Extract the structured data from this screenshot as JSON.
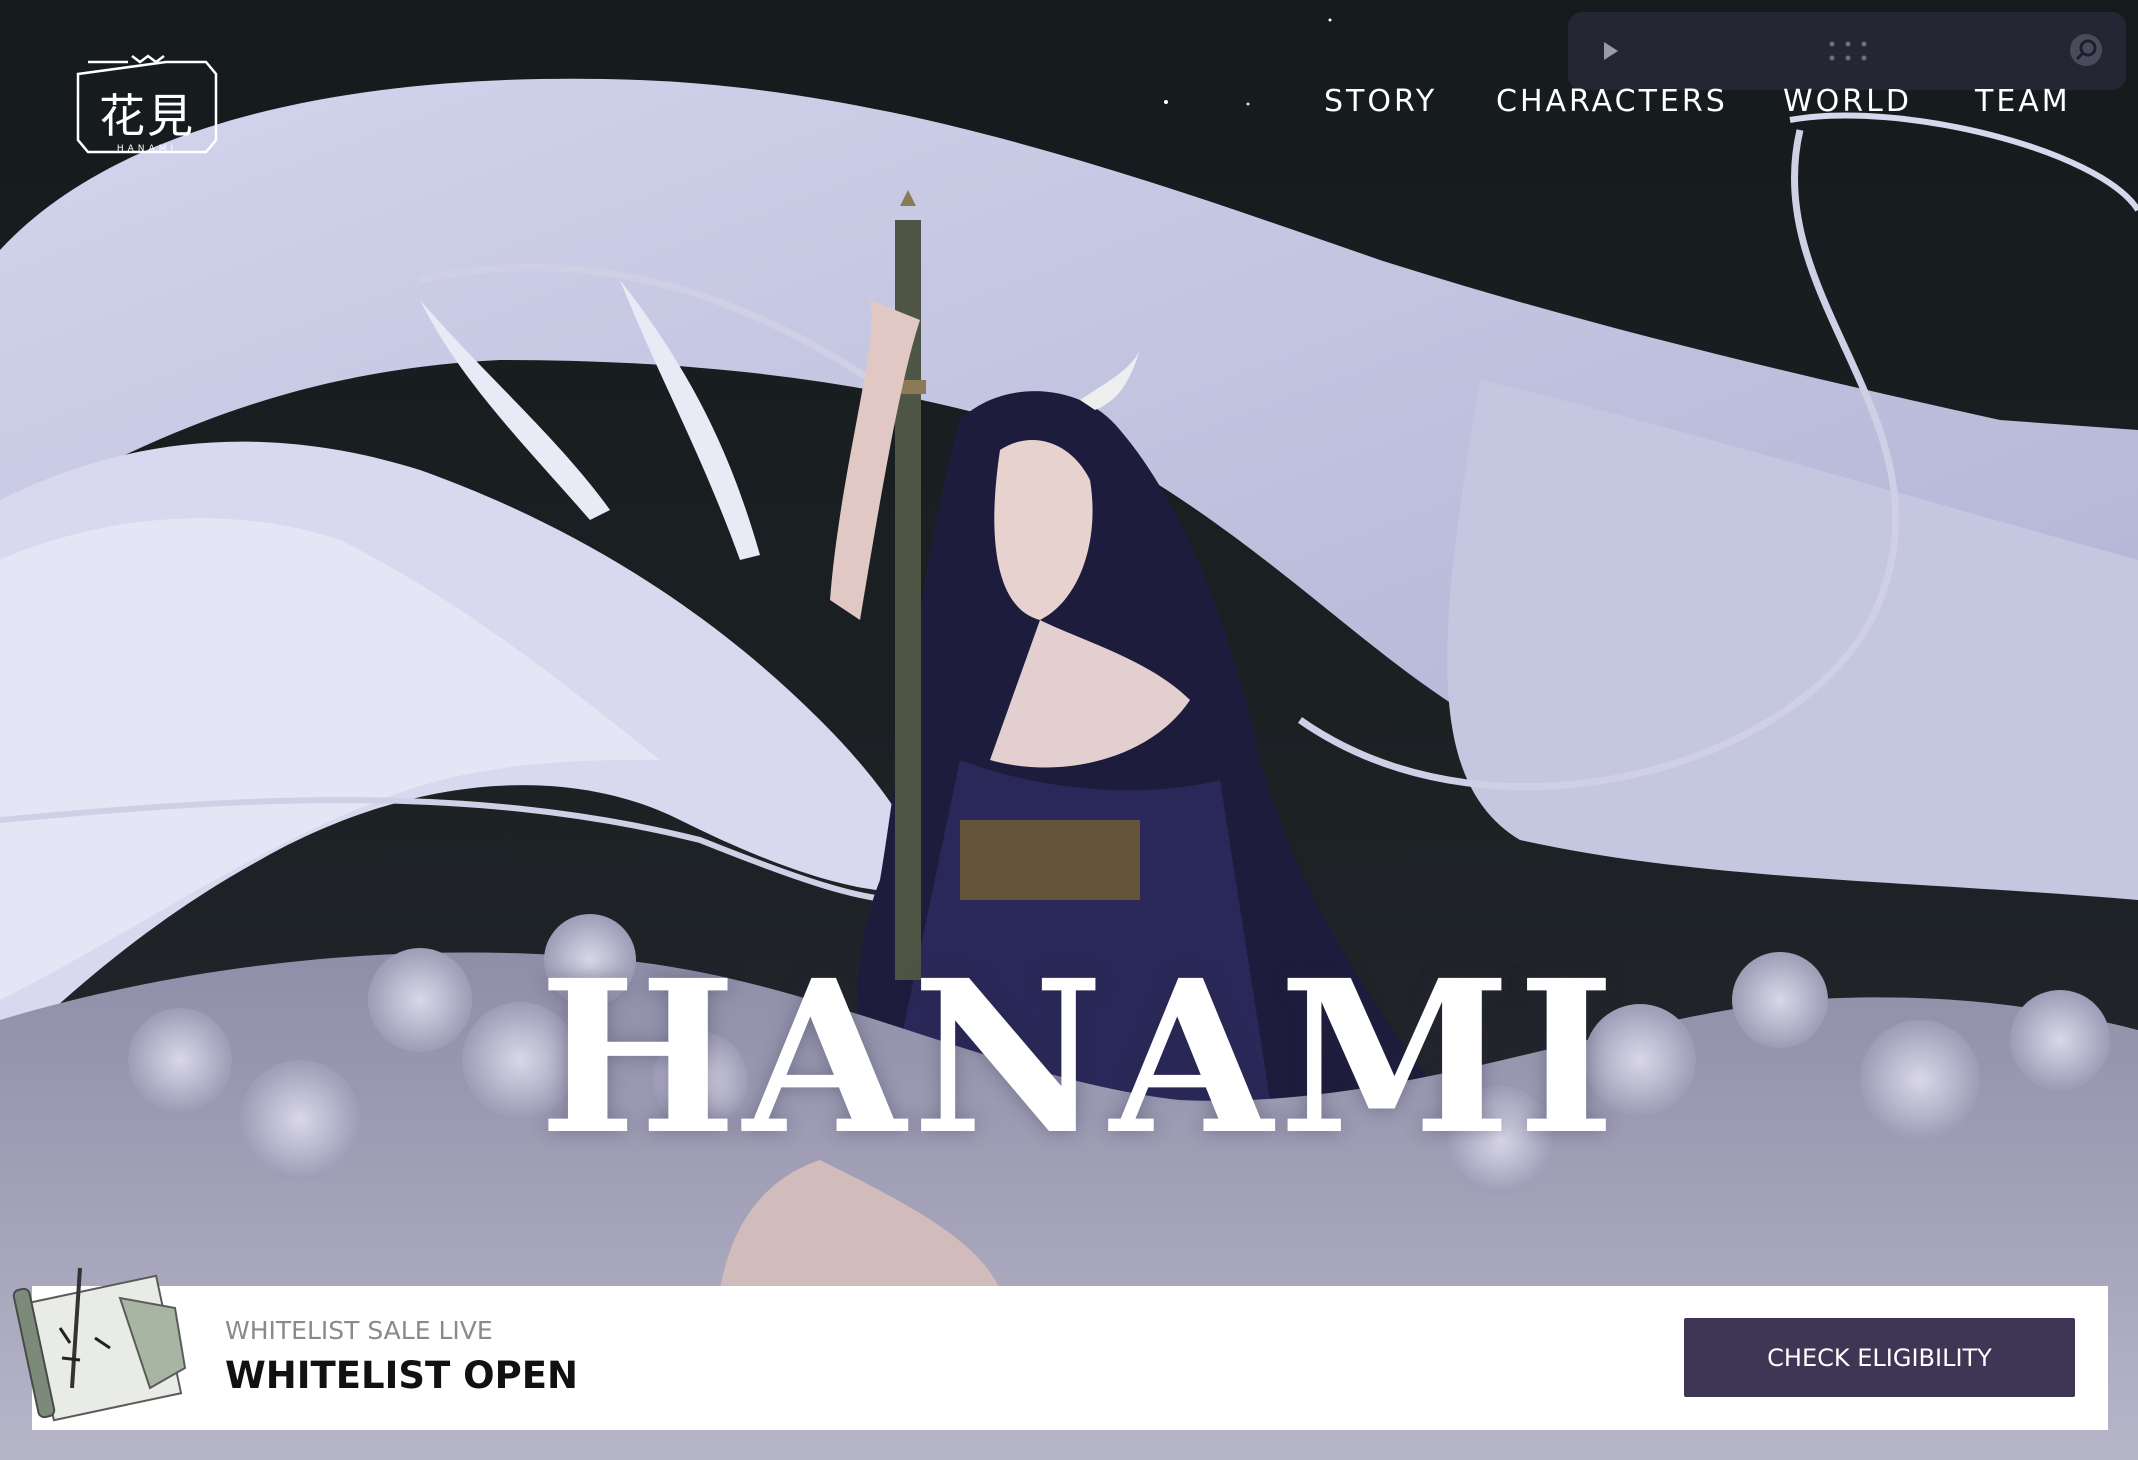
{
  "brand": {
    "logo_glyphs": "花見",
    "logo_sub": "HANAMI"
  },
  "nav": {
    "items": [
      {
        "label": "STORY"
      },
      {
        "label": "CHARACTERS"
      },
      {
        "label": "WORLD"
      },
      {
        "label": "TEAM"
      }
    ]
  },
  "player": {
    "icons": [
      "play-icon",
      "grip-dots-icon",
      "search-icon"
    ]
  },
  "hero": {
    "title": "HANAMI"
  },
  "banner": {
    "kicker": "WHITELIST SALE LIVE",
    "title": "WHITELIST OPEN",
    "cta_label": "CHECK ELIGIBILITY"
  },
  "colors": {
    "background": "#181d1f",
    "dragon": "#c9cbe4",
    "cta": "#3f3554",
    "banner": "#ffffff"
  }
}
